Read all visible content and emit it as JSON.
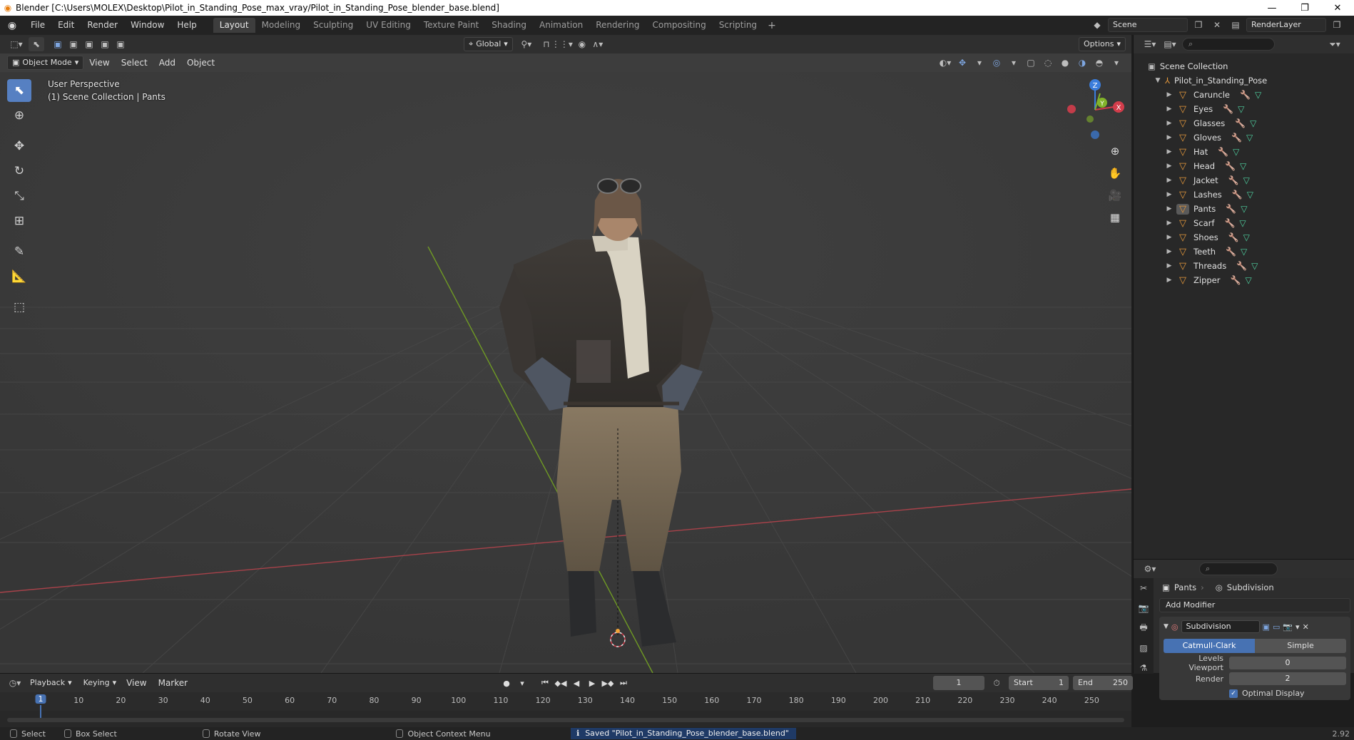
{
  "titlebar": {
    "title": "Blender [C:\\Users\\MOLEX\\Desktop\\Pilot_in_Standing_Pose_max_vray/Pilot_in_Standing_Pose_blender_base.blend]"
  },
  "menu": [
    "File",
    "Edit",
    "Render",
    "Window",
    "Help"
  ],
  "workspaces": [
    "Layout",
    "Modeling",
    "Sculpting",
    "UV Editing",
    "Texture Paint",
    "Shading",
    "Animation",
    "Rendering",
    "Compositing",
    "Scripting"
  ],
  "active_workspace": "Layout",
  "scene": {
    "name": "Scene",
    "render_layer": "RenderLayer"
  },
  "viewport": {
    "transform_orientation": "Global",
    "options_label": "Options",
    "mode": "Object Mode",
    "menus": [
      "View",
      "Select",
      "Add",
      "Object"
    ],
    "perspective": "User Perspective",
    "collection_info": "(1) Scene Collection | Pants"
  },
  "gizmo": {
    "z": "Z",
    "y": "Y",
    "x": "X"
  },
  "outliner": {
    "search_placeholder": "",
    "root": "Scene Collection",
    "parent": "Pilot_in_Standing_Pose",
    "items": [
      "Caruncle",
      "Eyes",
      "Glasses",
      "Gloves",
      "Hat",
      "Head",
      "Jacket",
      "Lashes",
      "Pants",
      "Scarf",
      "Shoes",
      "Teeth",
      "Threads",
      "Zipper"
    ],
    "selected": "Pants"
  },
  "properties": {
    "object": "Pants",
    "modifier": "Subdivision",
    "add_modifier": "Add Modifier",
    "modifier_name": "Subdivision",
    "mode_options": [
      "Catmull-Clark",
      "Simple"
    ],
    "active_mode": "Catmull-Clark",
    "levels_viewport_label": "Levels Viewport",
    "levels_viewport": "0",
    "render_label": "Render",
    "render_levels": "2",
    "optimal_display": "Optimal Display"
  },
  "timeline": {
    "menus": [
      "Playback",
      "Keying",
      "View",
      "Marker"
    ],
    "current_frame": "1",
    "start_label": "Start",
    "start": "1",
    "end_label": "End",
    "end": "250",
    "ticks": [
      "10",
      "20",
      "30",
      "40",
      "50",
      "60",
      "70",
      "80",
      "90",
      "100",
      "110",
      "120",
      "130",
      "140",
      "150",
      "160",
      "170",
      "180",
      "190",
      "200",
      "210",
      "220",
      "230",
      "240",
      "250"
    ]
  },
  "statusbar": {
    "select": "Select",
    "box_select": "Box Select",
    "rotate_view": "Rotate View",
    "context_menu": "Object Context Menu",
    "saved_message": "Saved \"Pilot_in_Standing_Pose_blender_base.blend\"",
    "version": "2.92"
  },
  "colors": {
    "accent": "#4772b3",
    "x_axis": "#d33d4b",
    "y_axis": "#82b32a",
    "z_axis": "#3b7ddb",
    "mesh_icon": "#e89a3c"
  }
}
